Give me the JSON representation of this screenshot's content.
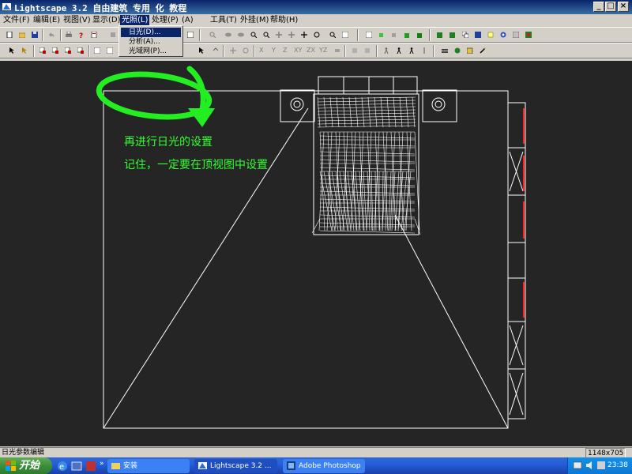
{
  "window": {
    "title": "Lightscape 3.2 自由建筑    专用    化         教程",
    "controls": [
      "_",
      "□",
      "×"
    ]
  },
  "menubar": {
    "items": [
      {
        "label": "文件(F)"
      },
      {
        "label": "编辑(E)"
      },
      {
        "label": "视图(V)"
      },
      {
        "label": "显示(D)"
      },
      {
        "label": "光照(L)"
      },
      {
        "label": "处理(P)"
      },
      {
        "label": "    (A)"
      },
      {
        "label": "工具(T)"
      },
      {
        "label": "外挂(M)"
      },
      {
        "label": "帮助(H)"
      }
    ],
    "active": "光照(L)"
  },
  "lighting_menu": {
    "items": [
      {
        "label": "日光(D)..."
      },
      {
        "label": "分析(A)..."
      },
      {
        "label": "光域网(P)..."
      }
    ],
    "selected": "日光(D)..."
  },
  "toolbar2": {
    "axis_labels": [
      "X",
      "Y",
      "Z",
      "XY",
      "ZX",
      "YZ"
    ]
  },
  "annotations": {
    "line1": "再进行日光的设置",
    "line2": "记住，一定要在顶视图中设置"
  },
  "status": {
    "text": "日光参数编辑",
    "resolution": "1148x705"
  },
  "taskbar": {
    "start_label": "开始",
    "quick_launch_more": "»",
    "tasks": [
      {
        "label": "安装",
        "icon": "folder-icon"
      },
      {
        "label": "Lightscape 3.2 ...",
        "icon": "lightscape-icon"
      },
      {
        "label": "Adobe Photoshop",
        "icon": "photoshop-icon"
      }
    ],
    "clock": "23:38"
  },
  "colors": {
    "viewport_bg": "#252525",
    "wireframe": "#ffffff",
    "annotation": "#33ff33",
    "highlight_circle": "#22ee22",
    "menu_highlight": "#0a246a",
    "accent_red": "#ff2020"
  }
}
